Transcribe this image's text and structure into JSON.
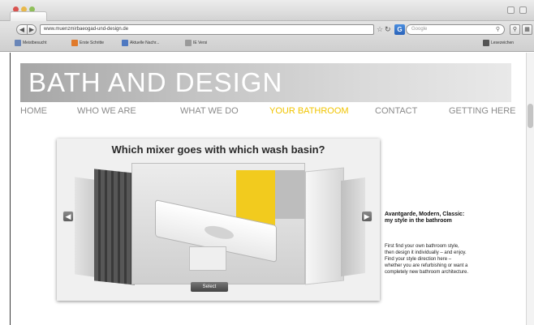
{
  "browser": {
    "url": "www.muenzmirbaeogad-und-design.de",
    "search_placeholder": "Google",
    "search_badge": "G",
    "bookmarks": [
      {
        "label": "Meistbesucht",
        "icon": "bookmark-icon",
        "color": "#6a86b8"
      },
      {
        "label": "Erste Schritte",
        "icon": "firefox-icon",
        "color": "#e07a2b"
      },
      {
        "label": "Aktuelle Nachr...",
        "icon": "rss-icon",
        "color": "#4f79c1"
      },
      {
        "label": "IE Versi",
        "icon": "page-icon",
        "color": "#9a9a9a"
      }
    ],
    "bookmarks_right": "Lesezeichen"
  },
  "site": {
    "brand": "BATH AND DESIGN",
    "nav": [
      {
        "label": "HOME",
        "active": false
      },
      {
        "label": "WHO WE ARE",
        "active": false
      },
      {
        "label": "WHAT WE DO",
        "active": false
      },
      {
        "label": "YOUR BATHROOM",
        "active": true
      },
      {
        "label": "CONTACT",
        "active": false
      },
      {
        "label": "GETTING HERE",
        "active": false
      }
    ],
    "slider": {
      "title": "Which mixer goes with which wash basin?",
      "select_label": "Select",
      "prev_icon": "arrow-left-icon",
      "next_icon": "arrow-right-icon"
    },
    "sidebar": {
      "heading": "Avantgarde, Modern, Classic: my style in the bathroom",
      "body": "First find your own bathroom style, then design it individually – and enjoy. Find your style direction here – whether you are refurbishing or want a completely new bathroom architecture."
    }
  },
  "colors": {
    "active_nav": "#f0c400",
    "nav_text": "#8a8a8a",
    "banner_start": "#a6a6a6",
    "banner_end": "#e9e9e9"
  }
}
